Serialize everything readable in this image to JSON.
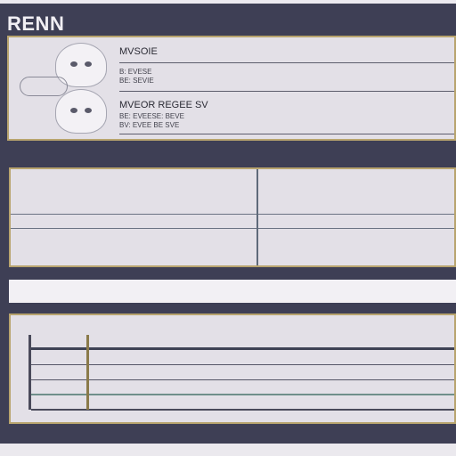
{
  "app": {
    "logo": "RENN"
  },
  "profile": {
    "rows": [
      {
        "title": "MVSOIE",
        "line1": "B: EVESE",
        "line2": "BE: SEVIE"
      },
      {
        "title": "MVEOR REGEE SV",
        "line1": "BE: EVEESE: BEVE",
        "line2": "BV: EVEE BE SVE"
      }
    ]
  },
  "colors": {
    "frame": "#3e3f55",
    "panel": "#e3e0e7",
    "accent_border": "#b8a46e"
  }
}
